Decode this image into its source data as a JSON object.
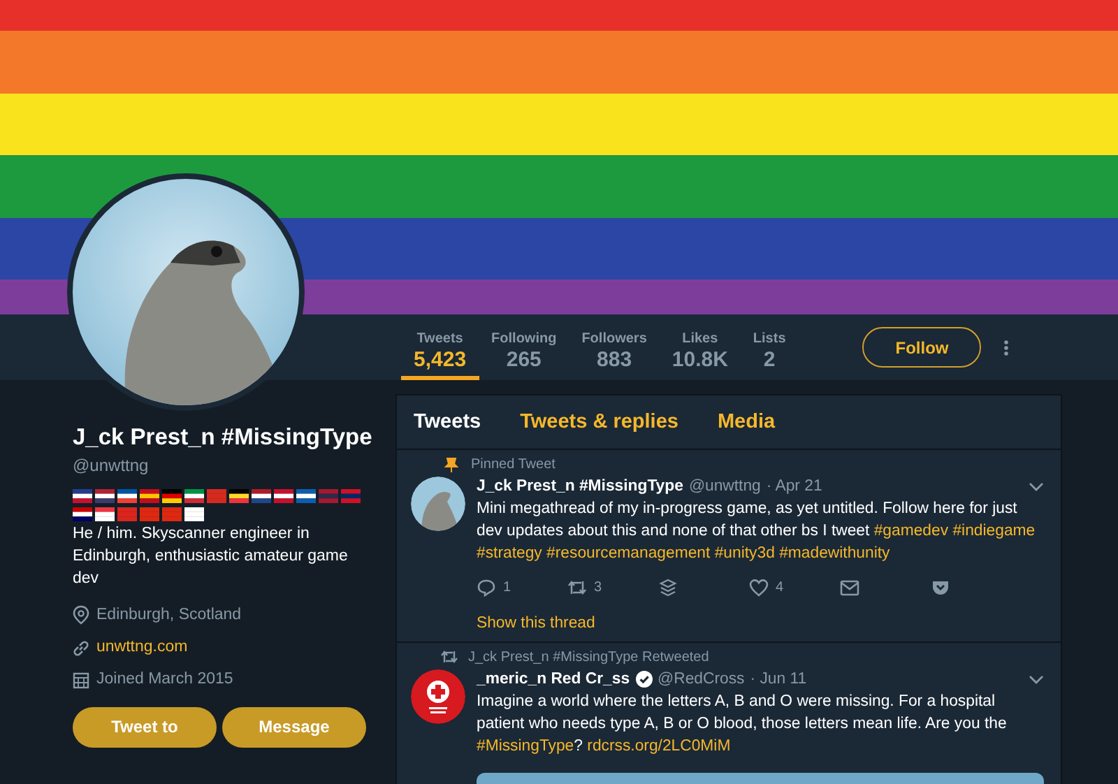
{
  "profile": {
    "name": "J_ck Prest_n #MissingType",
    "handle": "@unwttng",
    "bio": "He / him. Skyscanner engineer in Edinburgh, enthusiastic amateur game dev",
    "location": "Edinburgh, Scotland",
    "website": "unwttng.com",
    "joined": "Joined March 2015"
  },
  "profile_buttons": [
    "Tweet to",
    "Message"
  ],
  "stats": [
    {
      "label": "Tweets",
      "value": "5,423",
      "selected": true
    },
    {
      "label": "Following",
      "value": "265",
      "selected": false
    },
    {
      "label": "Followers",
      "value": "883",
      "selected": false
    },
    {
      "label": "Likes",
      "value": "10.8K",
      "selected": false
    },
    {
      "label": "Lists",
      "value": "2",
      "selected": false
    }
  ],
  "follow_button": "Follow",
  "tabs": [
    {
      "label": "Tweets",
      "selected": true
    },
    {
      "label": "Tweets & replies",
      "selected": false
    },
    {
      "label": "Media",
      "selected": false
    }
  ],
  "tweets": [
    {
      "context": {
        "kind": "pinned",
        "text": "Pinned Tweet"
      },
      "name": "J_ck Prest_n #MissingType",
      "verified": false,
      "handle": "@unwttng",
      "date": "· Apr 21",
      "avatar": {
        "kind": "bird"
      },
      "text": [
        {
          "kind": "plain",
          "text": "Mini megathread of my in-progress game, as yet untitled. Follow here for just dev updates about this and none of that other bs I tweet"
        },
        {
          "kind": "hashtag",
          "text": "#gamedev"
        },
        {
          "kind": "hashtag",
          "text": "#indiegame"
        },
        {
          "kind": "hashtag",
          "text": "#strategy"
        },
        {
          "kind": "hashtag",
          "text": "#resourcemanagement"
        },
        {
          "kind": "hashtag",
          "text": "#unity3d"
        },
        {
          "kind": "hashtag",
          "text": "#madewithunity"
        }
      ],
      "actions": {
        "replies": "1",
        "retweets": "3",
        "likes": "4"
      },
      "thread_link": "Show this thread",
      "media": false
    },
    {
      "context": {
        "kind": "retweet",
        "text": "J_ck Prest_n #MissingType Retweeted"
      },
      "name": "_meric_n Red Cr_ss",
      "verified": true,
      "handle": "@RedCross",
      "date": "· Jun 11",
      "avatar": {
        "kind": "cross"
      },
      "text": [
        {
          "kind": "plain",
          "text": "Imagine a world where the letters A, B and O were missing. For a hospital patient who needs type A, B or O blood, those letters mean life. Are you the"
        },
        {
          "kind": "hashtag",
          "text": "#MissingType"
        },
        {
          "kind": "punct",
          "text": "?"
        },
        {
          "kind": "link",
          "text": "rdcrss.org/2LC0MiM"
        }
      ],
      "media": true
    }
  ]
}
